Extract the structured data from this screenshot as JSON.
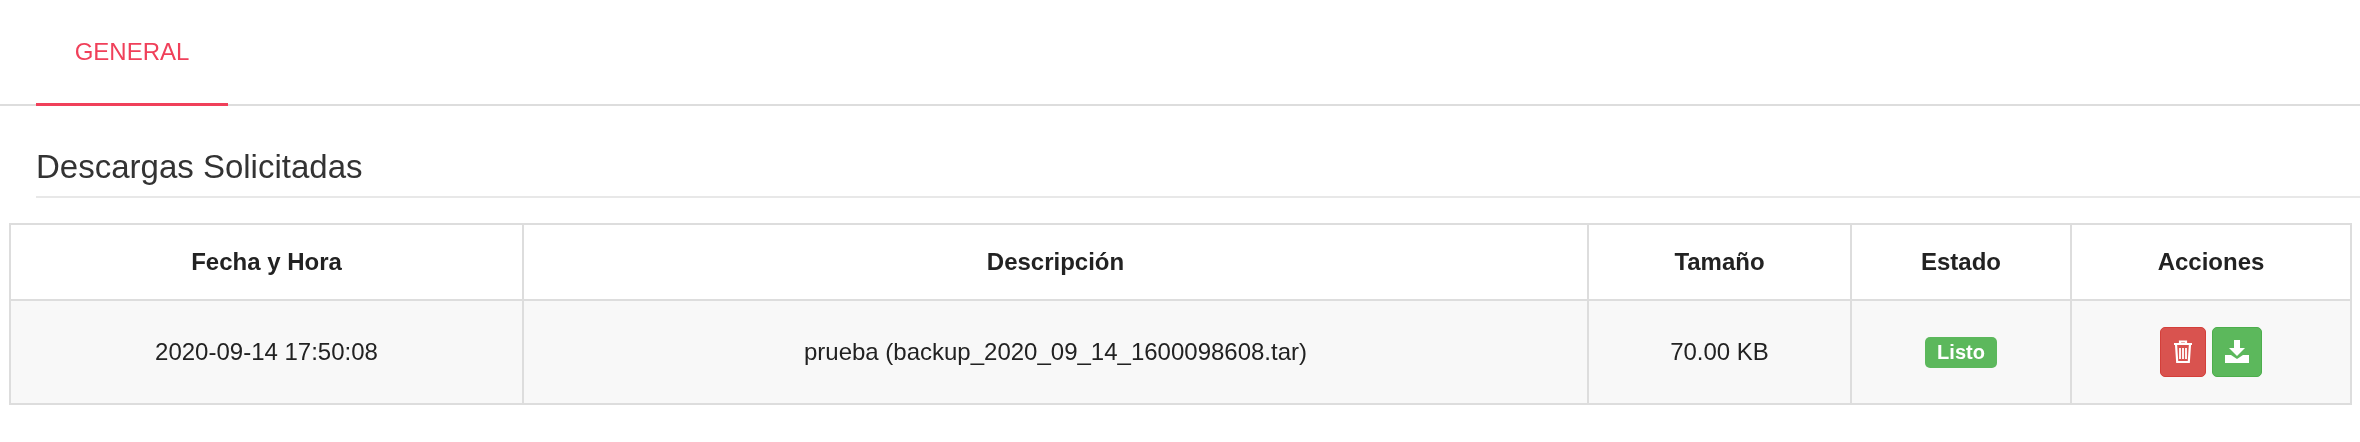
{
  "tabs": [
    {
      "label": "GENERAL",
      "selected": true
    }
  ],
  "section_title": "Descargas Solicitadas",
  "table": {
    "columns": [
      "Fecha y Hora",
      "Descripción",
      "Tamaño",
      "Estado",
      "Acciones"
    ],
    "rows": [
      {
        "datetime": "2020-09-14 17:50:08",
        "description": "prueba (backup_2020_09_14_1600098608.tar)",
        "size": "70.00 KB",
        "status": {
          "label": "Listo",
          "kind": "success"
        },
        "actions": [
          {
            "kind": "delete"
          },
          {
            "kind": "download"
          }
        ]
      }
    ]
  }
}
